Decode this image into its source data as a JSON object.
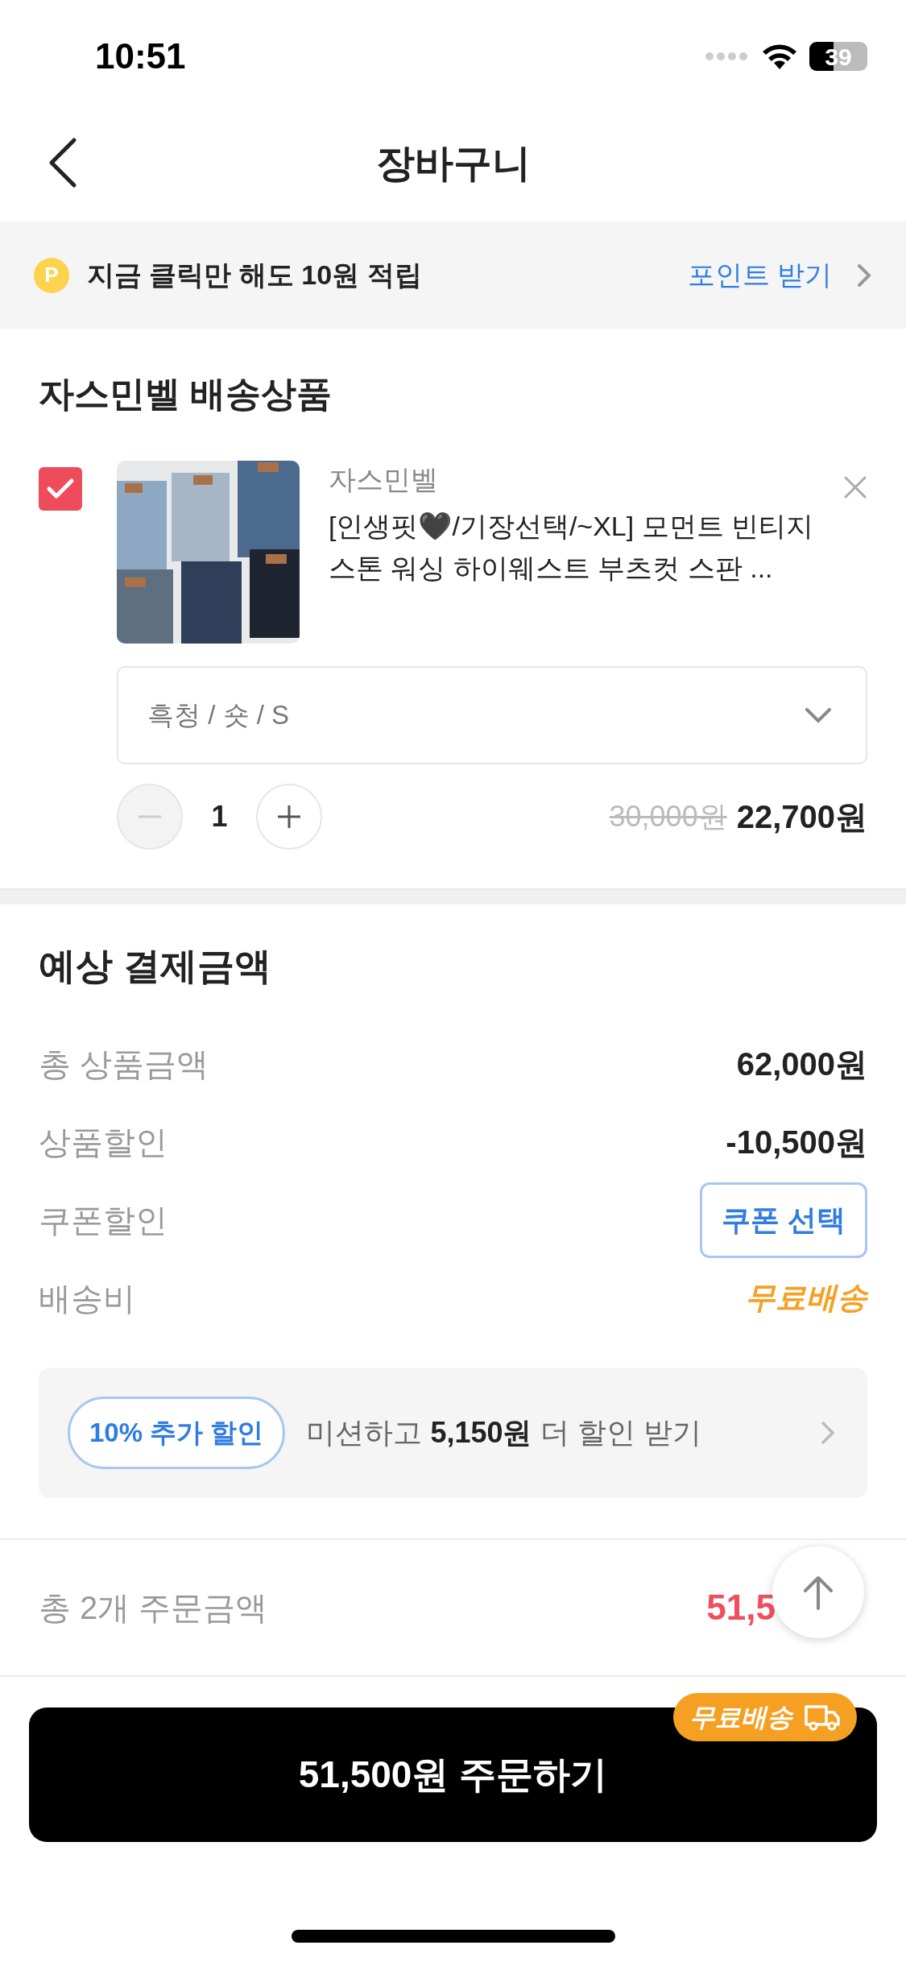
{
  "status_bar": {
    "time": "10:51",
    "battery": "39"
  },
  "header": {
    "title": "장바구니"
  },
  "points_banner": {
    "badge": "P",
    "message": "지금 클릭만 해도 10원 적립",
    "action": "포인트 받기"
  },
  "shop": {
    "title": "자스민벨 배송상품",
    "items": [
      {
        "checked": true,
        "brand": "자스민벨",
        "title": "[인생핏🖤/기장선택/~XL] 모먼트 빈티지 스톤 워싱 하이웨스트 부츠컷 스판 ...",
        "option": "흑청 / 숏 / S",
        "quantity": "1",
        "original_price": "30,000원",
        "price": "22,700원"
      }
    ]
  },
  "summary": {
    "title": "예상 결제금액",
    "rows": [
      {
        "kind": "value",
        "label": "총 상품금액",
        "value": "62,000원"
      },
      {
        "kind": "value",
        "label": "상품할인",
        "value": "-10,500원"
      },
      {
        "kind": "button",
        "label": "쿠폰할인",
        "value": "쿠폰 선택"
      },
      {
        "kind": "highlight",
        "label": "배송비",
        "value": "무료배송"
      }
    ],
    "mission": {
      "tag": "10% 추가 할인",
      "text": "미션하고 **5,150원** 더 할인 받기"
    }
  },
  "total": {
    "label": "총 2개 주문금액",
    "value": "51,5"
  },
  "order_button": {
    "label": "51,500원 주문하기",
    "badge": "무료배송"
  }
}
